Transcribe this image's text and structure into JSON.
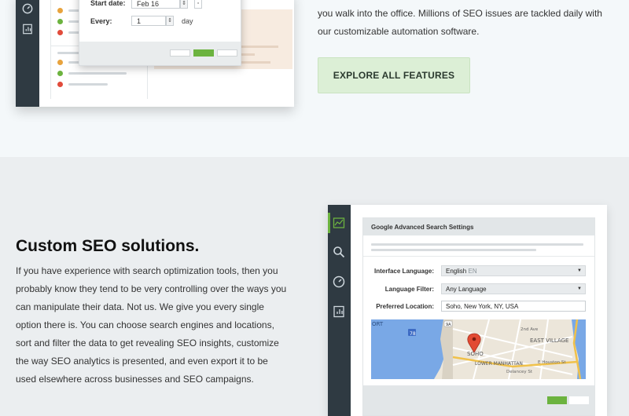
{
  "top": {
    "modal": {
      "start_date_label": "Start date:",
      "start_date_value": "Feb 16",
      "every_label": "Every:",
      "every_value": "1",
      "every_unit": "day"
    },
    "intro_text": "you walk into the office. Millions of SEO issues are tackled daily with our customizable automation software.",
    "explore_button": "EXPLORE ALL FEATURES"
  },
  "bottom": {
    "title_bold": "Custom",
    "title_rest": "SEO solutions.",
    "body": "If you have experience with search optimization tools, then you probably know they tend to be very controlling over the ways you can manipulate their data. Not us. We give you every single option there is. You can choose search engines and locations, sort and filter the data to get revealing SEO insights, customize the way SEO analytics is presented, and even export it to be used elsewhere across businesses and SEO campaigns.",
    "settings": {
      "header": "Google Advanced Search Settings",
      "interface_language_label": "Interface Language:",
      "interface_language_value": "English",
      "interface_language_code": "EN",
      "language_filter_label": "Language Filter:",
      "language_filter_value": "Any Language",
      "preferred_location_label": "Preferred Location:",
      "preferred_location_value": "Soho, New York, NY, USA",
      "map_labels": {
        "port": "ORT",
        "route": "78",
        "route2": "9A",
        "east_village": "EAST VILLAGE",
        "soho": "SOHO",
        "lower_manhattan": "LOWER MANHATTAN",
        "delancey": "Delancey St",
        "houston": "E Houston St",
        "second_ave": "2nd Ave"
      }
    }
  },
  "colors": {
    "accent_green": "#6cb33f",
    "rail_dark": "#2f3a42",
    "button_bg": "#dcefd6"
  }
}
